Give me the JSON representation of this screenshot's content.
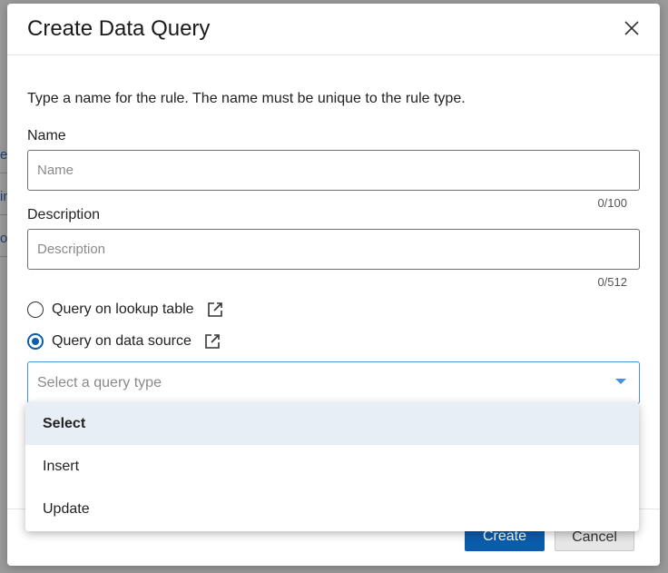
{
  "background": {
    "fragments": [
      "eN",
      "in",
      "or"
    ]
  },
  "modal": {
    "title": "Create Data Query",
    "intro": "Type a name for the rule. The name must be unique to the rule type.",
    "name": {
      "label": "Name",
      "placeholder": "Name",
      "value": "",
      "counter": "0/100"
    },
    "description": {
      "label": "Description",
      "placeholder": "Description",
      "value": "",
      "counter": "0/512"
    },
    "query_options": [
      {
        "label": "Query on lookup table",
        "checked": false
      },
      {
        "label": "Query on data source",
        "checked": true
      }
    ],
    "query_type": {
      "placeholder": "Select a query type",
      "options": [
        "Select",
        "Insert",
        "Update"
      ],
      "highlighted": "Select"
    },
    "buttons": {
      "create": "Create",
      "cancel": "Cancel"
    }
  },
  "colors": {
    "primary": "#0b5cad",
    "focus_border": "#4a90d9",
    "highlight": "#e8eef6"
  },
  "icons": {
    "close": "close-icon",
    "external_link": "external-link-icon",
    "caret": "caret-down-icon"
  }
}
